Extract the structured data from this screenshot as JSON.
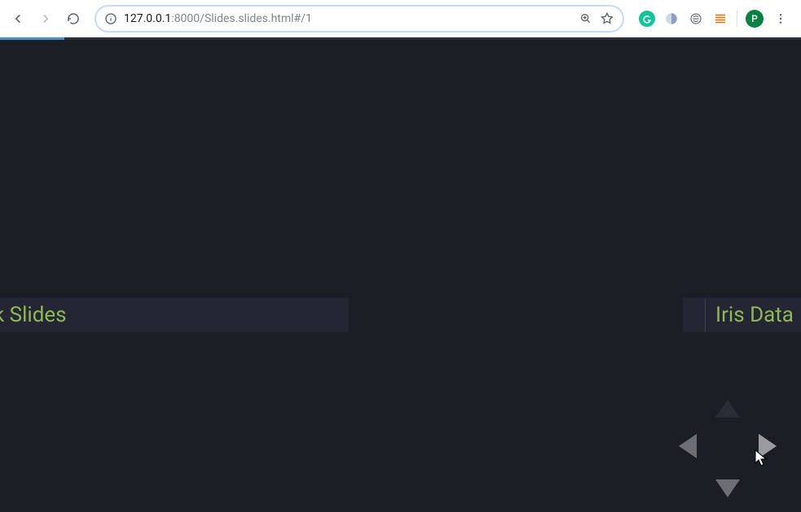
{
  "browser": {
    "url_host": "127.0.0.1",
    "url_port": ":8000",
    "url_path": "/Slides.slides.html#/1",
    "profile_initial": "P"
  },
  "presentation": {
    "left_slide_title_fragment": "k Slides",
    "right_slide_title_fragment": "Iris Data",
    "progress_percent": 8
  }
}
